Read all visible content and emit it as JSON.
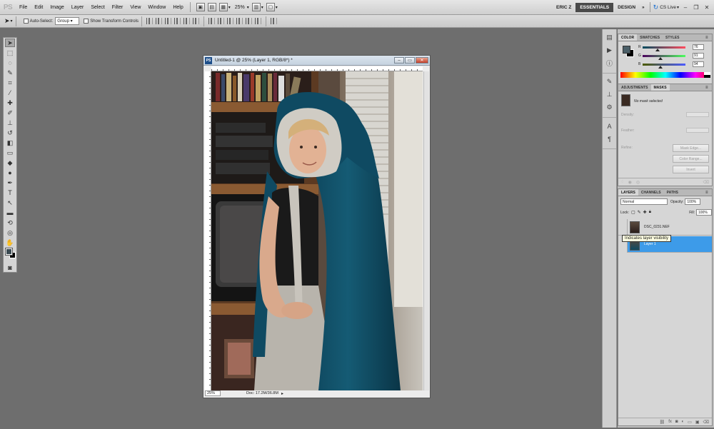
{
  "app": {
    "logo": "PS",
    "menu": [
      "File",
      "Edit",
      "Image",
      "Layer",
      "Select",
      "Filter",
      "View",
      "Window",
      "Help"
    ],
    "zoom": "25%",
    "user": "ERIC Z",
    "workspaces": [
      "ESSENTIALS",
      "DESIGN"
    ],
    "active_workspace": "ESSENTIALS",
    "more": "»",
    "cs_live": "CS Live"
  },
  "options_bar": {
    "auto_select_label": "Auto-Select:",
    "auto_select_value": "Group",
    "transform_label": "Show Transform Controls"
  },
  "document": {
    "title": "Untitled-1 @ 25% (Layer 1, RGB/8*) *",
    "zoom": "25%",
    "doc_size": "Doc: 17.2M/36.8M"
  },
  "color_panel": {
    "tabs": [
      "COLOR",
      "SWATCHES",
      "STYLES"
    ],
    "channels": [
      {
        "label": "R",
        "value": "76",
        "fraction": 0.3,
        "gradient_from": "#004b5e",
        "gradient_to": "#ff4b5e"
      },
      {
        "label": "G",
        "value": "91",
        "fraction": 0.36,
        "gradient_from": "#4c005e",
        "gradient_to": "#4cff5e"
      },
      {
        "label": "B",
        "value": "94",
        "fraction": 0.37,
        "gradient_from": "#4c5b00",
        "gradient_to": "#4c5bff"
      }
    ],
    "fg_color": "#4b5f68",
    "bg_color": "#000000"
  },
  "adjustments_panel": {
    "tabs": [
      "ADJUSTMENTS",
      "MASKS"
    ],
    "status": "No mask selected",
    "density_label": "Density:",
    "feather_label": "Feather:",
    "refine_label": "Refine:",
    "buttons": [
      "Mask Edge...",
      "Color Range...",
      "Invert"
    ]
  },
  "layers_panel": {
    "tabs": [
      "LAYERS",
      "CHANNELS",
      "PATHS"
    ],
    "blend_mode": "Normal",
    "opacity_label": "Opacity:",
    "opacity": "100%",
    "lock_label": "Lock:",
    "fill_label": "Fill:",
    "fill": "100%",
    "layers": [
      {
        "name": "DSC_0231.NEF",
        "selected": false
      },
      {
        "name": "Layer 1",
        "selected": true
      }
    ],
    "tooltip": "Indicates layer visibility"
  }
}
